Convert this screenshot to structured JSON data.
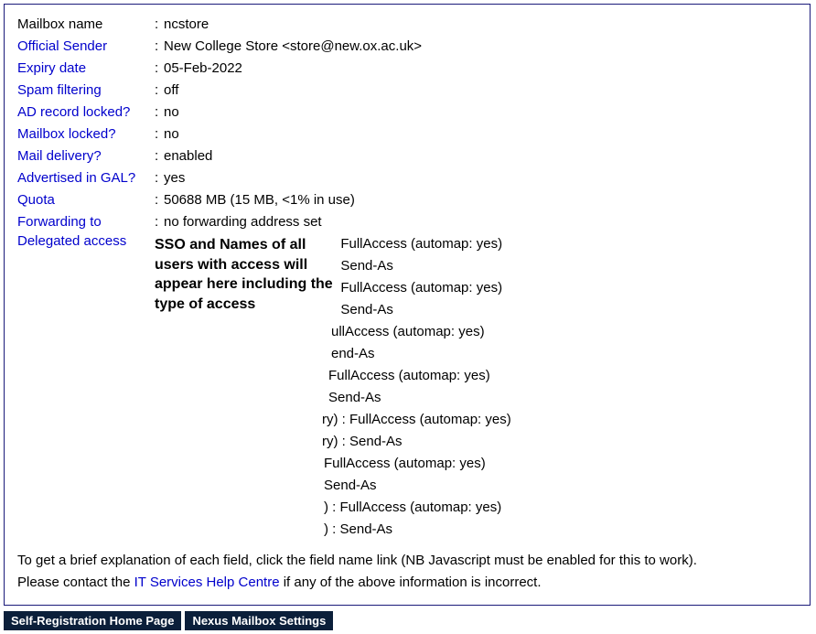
{
  "fields": {
    "mailbox_name": {
      "label": "Mailbox name",
      "value": "ncstore",
      "link": false
    },
    "official_sender": {
      "label": "Official Sender",
      "value": "New College Store <store@new.ox.ac.uk>",
      "link": true
    },
    "expiry_date": {
      "label": "Expiry date",
      "value": "05-Feb-2022",
      "link": true
    },
    "spam_filtering": {
      "label": "Spam filtering",
      "value": "off",
      "link": true
    },
    "ad_record_locked": {
      "label": "AD record locked?",
      "value": "no",
      "link": true
    },
    "mailbox_locked": {
      "label": "Mailbox locked?",
      "value": "no",
      "link": true
    },
    "mail_delivery": {
      "label": "Mail delivery?",
      "value": "enabled",
      "link": true
    },
    "advertised_in_gal": {
      "label": "Advertised in GAL?",
      "value": "yes",
      "link": true
    },
    "quota": {
      "label": "Quota",
      "value": "50688 MB (15 MB, <1% in use)",
      "link": true
    },
    "forwarding_to": {
      "label": "Forwarding to",
      "value": "no forwarding address set",
      "link": true
    }
  },
  "delegated": {
    "label": "Delegated access",
    "annotation": "SSO and Names of all users with access will appear here including the type of access",
    "entries": [
      {
        "prefix": ": ",
        "text": "FullAccess (automap: yes)"
      },
      {
        "prefix": ": ",
        "text": "Send-As"
      },
      {
        "prefix": ": ",
        "text": "FullAccess (automap: yes)"
      },
      {
        "prefix": ": ",
        "text": "Send-As"
      },
      {
        "prefix": "",
        "text": "ullAccess (automap: yes)"
      },
      {
        "prefix": "",
        "text": "end-As"
      },
      {
        "prefix": "",
        "text": "FullAccess (automap: yes)"
      },
      {
        "prefix": "",
        "text": "Send-As"
      },
      {
        "prefix": "ry) : ",
        "text": "FullAccess (automap: yes)"
      },
      {
        "prefix": "ry) : ",
        "text": "Send-As"
      },
      {
        "prefix": "",
        "text": "FullAccess (automap: yes)"
      },
      {
        "prefix": "",
        "text": "Send-As"
      },
      {
        "prefix": ") : ",
        "text": "FullAccess (automap: yes)"
      },
      {
        "prefix": ") : ",
        "text": "Send-As"
      }
    ],
    "entry_indents": [
      195,
      195,
      195,
      195,
      193,
      193,
      190,
      190,
      183,
      183,
      185,
      185,
      185,
      185
    ]
  },
  "footer": {
    "line1": "To get a brief explanation of each field, click the field name link (NB Javascript must be enabled for this to work).",
    "line2_pre": "Please contact the ",
    "line2_link": "IT Services Help Centre",
    "line2_post": " if any of the above information is incorrect."
  },
  "nav": {
    "self_reg": "Self-Registration Home Page",
    "nexus": "Nexus Mailbox Settings"
  }
}
